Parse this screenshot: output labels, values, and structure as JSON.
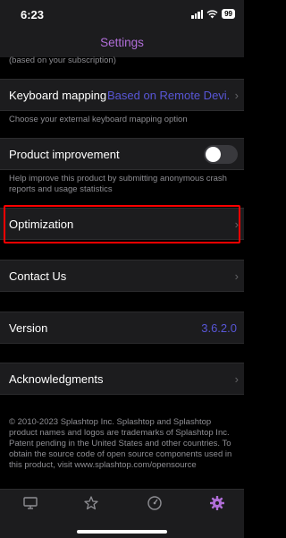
{
  "status_bar": {
    "time": "6:23",
    "battery": "99"
  },
  "nav": {
    "title": "Settings"
  },
  "subscription_note": "(based on your subscription)",
  "keyboard_mapping": {
    "label": "Keyboard mapping",
    "value": "Based on Remote Devi...",
    "helper": "Choose your external keyboard mapping option"
  },
  "product_improvement": {
    "label": "Product improvement",
    "enabled": false,
    "helper": "Help improve this product by submitting anonymous crash reports and usage statistics"
  },
  "optimization": {
    "label": "Optimization"
  },
  "contact": {
    "label": "Contact Us"
  },
  "version": {
    "label": "Version",
    "value": "3.6.2.0"
  },
  "acknowledgments": {
    "label": "Acknowledgments"
  },
  "copyright": "© 2010-2023 Splashtop Inc. Splashtop and Splashtop product names and logos are trademarks of Splashtop Inc. Patent pending in the United States and other countries. To obtain the source code of open source components used in this product, visit www.splashtop.com/opensource",
  "tabs": [
    {
      "icon": "monitor-icon",
      "active": false
    },
    {
      "icon": "star-icon",
      "active": false
    },
    {
      "icon": "gauge-icon",
      "active": false
    },
    {
      "icon": "gear-icon",
      "active": true
    }
  ],
  "colors": {
    "accent": "#b06ed8",
    "value": "#5856d6",
    "highlight": "#ff0000"
  }
}
